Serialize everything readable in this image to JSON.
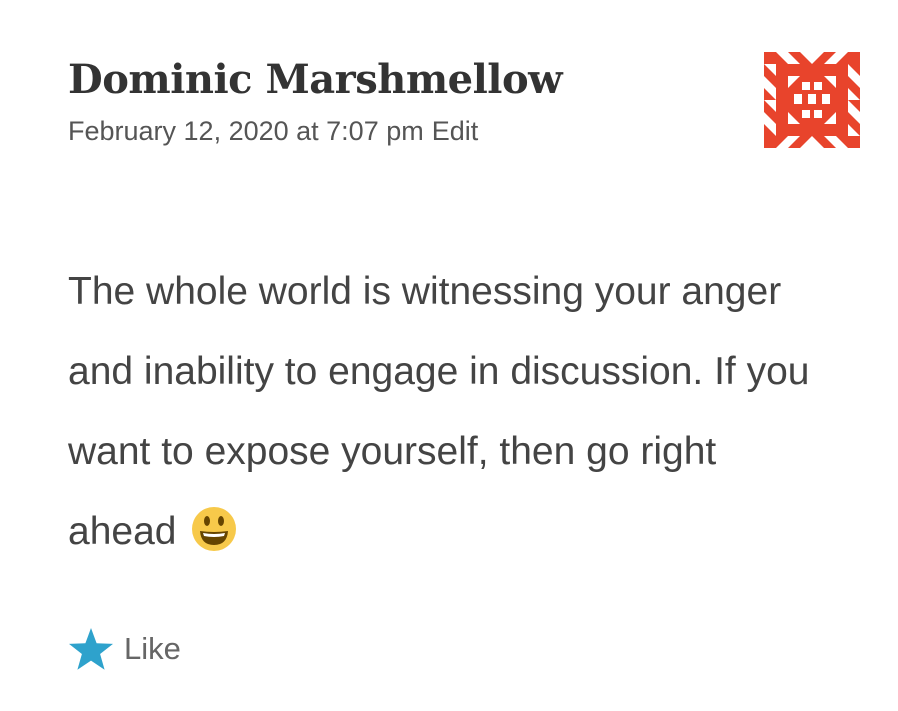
{
  "comment": {
    "author": "Dominic Marshmellow",
    "date": "February 12, 2020 at 7:07 pm",
    "edit_label": "Edit",
    "text": "The whole world is witnessing your anger and inability to engage in discussion. If you want to expose yourself, then go right ahead",
    "emoji": "smiley-face-icon",
    "like_label": "Like"
  },
  "icons": {
    "avatar": "identicon-avatar",
    "like": "star-icon"
  },
  "colors": {
    "avatar": "#e8442c",
    "like_star": "#2ea2cc",
    "emoji_face": "#f7c94a"
  }
}
